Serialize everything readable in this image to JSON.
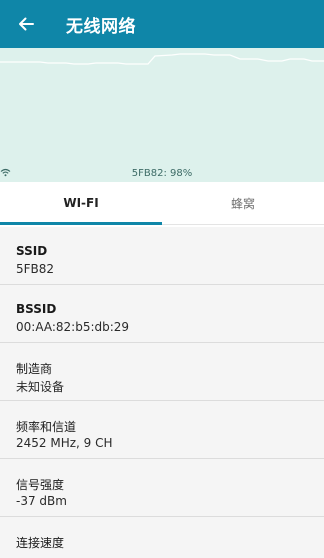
{
  "appbar": {
    "title": "无线网络",
    "back_icon": "arrow-left-icon",
    "color": "#0f86a8"
  },
  "chart": {
    "background_color": "#ddf1ec",
    "line_color": "#ffffff",
    "signal_label": "5FB82: 98%",
    "signal_icon": "wifi-icon"
  },
  "tabs": [
    {
      "label": "WI-FI",
      "selected": true
    },
    {
      "label": "蜂窝",
      "selected": false
    }
  ],
  "details": [
    {
      "label": "SSID",
      "value": "5FB82"
    },
    {
      "label": "BSSID",
      "value": "00:AA:82:b5:db:29"
    },
    {
      "label": "制造商",
      "value": "未知设备"
    },
    {
      "label": "频率和信道",
      "value": "2452 MHz, 9 CH"
    },
    {
      "label": "信号强度",
      "value": "-37 dBm"
    },
    {
      "label": "连接速度",
      "value": ""
    }
  ]
}
